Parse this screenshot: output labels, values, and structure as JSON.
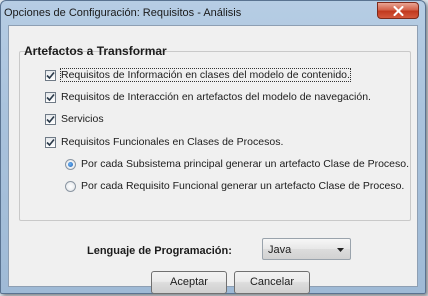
{
  "window": {
    "title": "Opciones de Configuración: Requisitos - Análisis"
  },
  "group": {
    "title": "Artefactos a Transformar",
    "checkboxes": [
      {
        "label": "Requisitos de Información en clases del modelo de contenido.",
        "checked": true
      },
      {
        "label": "Requisitos de Interacción en artefactos del modelo de navegación.",
        "checked": true
      },
      {
        "label": "Servicios",
        "checked": true
      },
      {
        "label": "Requisitos Funcionales en Clases de Procesos.",
        "checked": true
      }
    ],
    "radios": [
      {
        "label": "Por cada Subsistema principal generar un artefacto Clase de Proceso.",
        "selected": true
      },
      {
        "label": "Por cada Requisito Funcional generar un artefacto Clase de Proceso.",
        "selected": false
      }
    ]
  },
  "language": {
    "label": "Lenguaje de Programación:",
    "value": "Java"
  },
  "buttons": {
    "accept": "Aceptar",
    "cancel": "Cancelar"
  },
  "colors": {
    "accent": "#1a5fb4",
    "close": "#c2391f"
  }
}
